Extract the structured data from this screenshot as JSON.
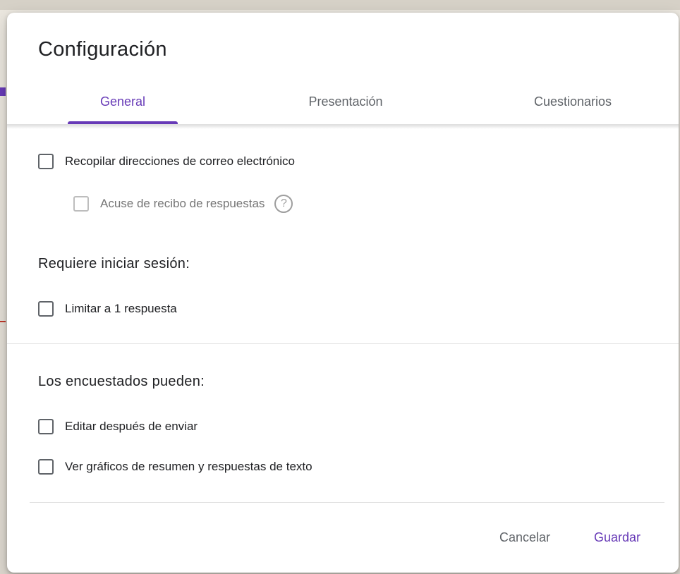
{
  "dialog": {
    "title": "Configuración",
    "tabs": [
      {
        "label": "General",
        "active": true
      },
      {
        "label": "Presentación",
        "active": false
      },
      {
        "label": "Cuestionarios",
        "active": false
      }
    ],
    "options": {
      "collect_emails": {
        "label": "Recopilar direcciones de correo electrónico",
        "checked": false
      },
      "response_receipts": {
        "label": "Acuse de recibo de respuestas",
        "checked": false,
        "disabled": true,
        "help_icon": "help-circle-icon"
      }
    },
    "sign_in_section": {
      "heading": "Requiere iniciar sesión:",
      "limit_one": {
        "label": "Limitar a 1 respuesta",
        "checked": false
      }
    },
    "respondents_section": {
      "heading": "Los encuestados pueden:",
      "edit_after_submit": {
        "label": "Editar después de enviar",
        "checked": false
      },
      "see_summary": {
        "label": "Ver gráficos de resumen y respuestas de texto",
        "checked": false
      }
    },
    "footer": {
      "cancel_label": "Cancelar",
      "save_label": "Guardar"
    }
  },
  "colors": {
    "accent": "#673ab7",
    "text_primary": "#202124",
    "text_secondary": "#5f6368"
  }
}
